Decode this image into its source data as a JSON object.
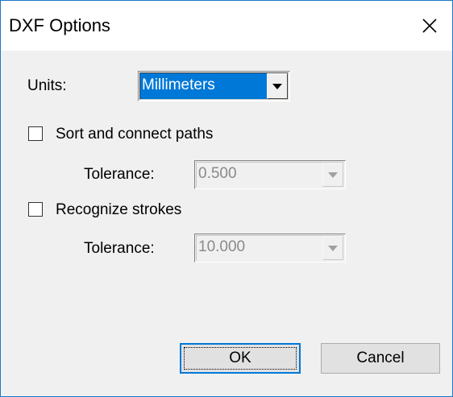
{
  "window": {
    "title": "DXF Options",
    "close_icon": "close-icon"
  },
  "units": {
    "label": "Units:",
    "value": "Millimeters"
  },
  "sort_paths": {
    "label": "Sort and connect paths",
    "checked": false,
    "tolerance_label": "Tolerance:",
    "tolerance_value": "0.500"
  },
  "recognize_strokes": {
    "label": "Recognize strokes",
    "checked": false,
    "tolerance_label": "Tolerance:",
    "tolerance_value": "10.000"
  },
  "buttons": {
    "ok_label": "OK",
    "cancel_label": "Cancel"
  },
  "colors": {
    "accent": "#0078d7",
    "border": "#1979ca"
  }
}
